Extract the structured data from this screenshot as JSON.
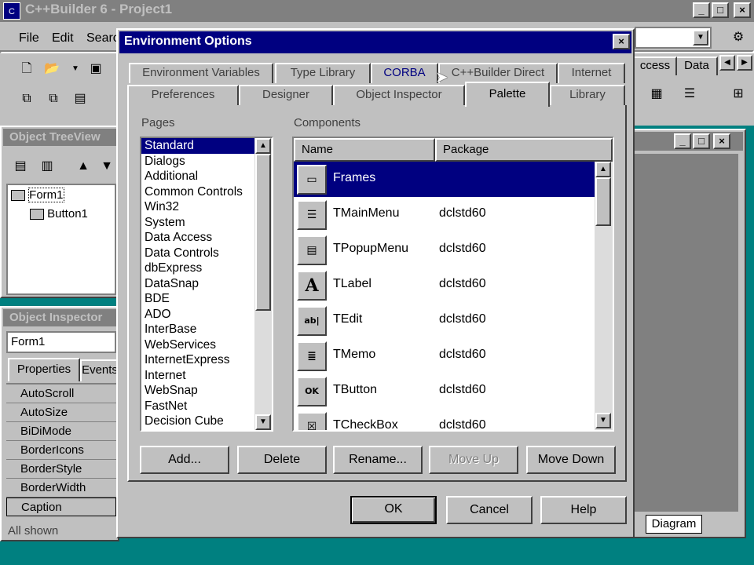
{
  "main_window": {
    "title": "C++Builder 6 - Project1",
    "menu": [
      "File",
      "Edit",
      "Search"
    ],
    "palette_tabs": [
      "ccess",
      "Data"
    ]
  },
  "object_treeview": {
    "title": "Object TreeView",
    "items": [
      "Form1",
      "Button1"
    ]
  },
  "object_inspector": {
    "title": "Object Inspector",
    "selected_object": "Form1",
    "tabs": [
      "Properties",
      "Events"
    ],
    "properties": [
      "AutoScroll",
      "AutoSize",
      "BiDiMode",
      "BorderIcons",
      "BorderStyle",
      "BorderWidth",
      "Caption"
    ],
    "status": "All shown"
  },
  "form_designer": {
    "tab": "Diagram"
  },
  "dialog": {
    "title": "Environment Options",
    "tabs_row1": [
      "Environment Variables",
      "Type Library",
      "CORBA",
      "C++Builder Direct",
      "Internet"
    ],
    "tabs_row2": [
      "Preferences",
      "Designer",
      "Object Inspector",
      "Palette",
      "Library"
    ],
    "active_tab": "Palette",
    "pages_label": "Pages",
    "pages": [
      "Standard",
      "Dialogs",
      "Additional",
      "Common Controls",
      "Win32",
      "System",
      "Data Access",
      "Data Controls",
      "dbExpress",
      "DataSnap",
      "BDE",
      "ADO",
      "InterBase",
      "WebServices",
      "InternetExpress",
      "Internet",
      "WebSnap",
      "FastNet",
      "Decision Cube"
    ],
    "components_label": "Components",
    "columns": [
      "Name",
      "Package"
    ],
    "components": [
      {
        "name": "Frames",
        "package": "",
        "icon": "frame-icon"
      },
      {
        "name": "TMainMenu",
        "package": "dclstd60",
        "icon": "mainmenu-icon"
      },
      {
        "name": "TPopupMenu",
        "package": "dclstd60",
        "icon": "popupmenu-icon"
      },
      {
        "name": "TLabel",
        "package": "dclstd60",
        "icon": "label-icon"
      },
      {
        "name": "TEdit",
        "package": "dclstd60",
        "icon": "edit-icon"
      },
      {
        "name": "TMemo",
        "package": "dclstd60",
        "icon": "memo-icon"
      },
      {
        "name": "TButton",
        "package": "dclstd60",
        "icon": "button-icon"
      },
      {
        "name": "TCheckBox",
        "package": "dclstd60",
        "icon": "checkbox-icon"
      }
    ],
    "action_buttons": [
      "Add...",
      "Delete",
      "Rename...",
      "Move Up",
      "Move Down"
    ],
    "footer_buttons": [
      "OK",
      "Cancel",
      "Help"
    ]
  }
}
